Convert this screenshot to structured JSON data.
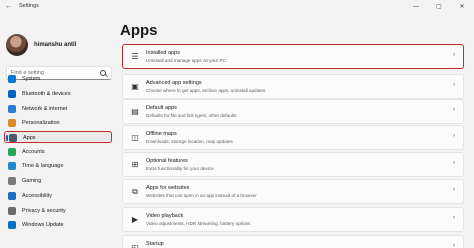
{
  "window": {
    "back_glyph": "←",
    "title": "Settings",
    "controls": [
      "—",
      "▢",
      "✕"
    ]
  },
  "profile": {
    "name": "himanshu antil"
  },
  "search": {
    "placeholder": "Find a setting"
  },
  "nav": [
    {
      "label": "System",
      "icon": "system-icon",
      "color": "#0078d4"
    },
    {
      "label": "Bluetooth & devices",
      "icon": "bluetooth-icon",
      "color": "#0067c0"
    },
    {
      "label": "Network & internet",
      "icon": "network-icon",
      "color": "#2b7bd6"
    },
    {
      "label": "Personalization",
      "icon": "brush-icon",
      "color": "#d88b2c"
    },
    {
      "label": "Apps",
      "icon": "apps-icon",
      "color": "#4a5a6a",
      "active": true
    },
    {
      "label": "Accounts",
      "icon": "accounts-icon",
      "color": "#2aa55a"
    },
    {
      "label": "Time & language",
      "icon": "globe-icon",
      "color": "#1f8ad1"
    },
    {
      "label": "Gaming",
      "icon": "gaming-icon",
      "color": "#7a7a7a"
    },
    {
      "label": "Accessibility",
      "icon": "accessibility-icon",
      "color": "#1f6fbf"
    },
    {
      "label": "Privacy & security",
      "icon": "shield-icon",
      "color": "#6b6b6b"
    },
    {
      "label": "Windows Update",
      "icon": "update-icon",
      "color": "#0a6fc6"
    }
  ],
  "main": {
    "title": "Apps",
    "items": [
      {
        "title": "Installed apps",
        "desc": "Uninstall and manage apps on your PC",
        "icon": "list-icon",
        "glyph": "☰"
      },
      {
        "title": "Advanced app settings",
        "desc": "Choose where to get apps, archive apps, uninstall updates",
        "icon": "app-settings-icon",
        "glyph": "▣"
      },
      {
        "title": "Default apps",
        "desc": "Defaults for file and link types, other defaults",
        "icon": "default-apps-icon",
        "glyph": "▤"
      },
      {
        "title": "Offline maps",
        "desc": "Downloads, storage location, map updates",
        "icon": "map-icon",
        "glyph": "◫"
      },
      {
        "title": "Optional features",
        "desc": "Extra functionality for your device",
        "icon": "features-icon",
        "glyph": "⊞"
      },
      {
        "title": "Apps for websites",
        "desc": "Websites that can open in an app instead of a browser",
        "icon": "web-apps-icon",
        "glyph": "⧉"
      },
      {
        "title": "Video playback",
        "desc": "Video adjustments, HDR streaming, battery options",
        "icon": "video-icon",
        "glyph": "▶"
      },
      {
        "title": "Startup",
        "desc": "",
        "icon": "startup-icon",
        "glyph": "◰"
      }
    ],
    "chevron": "›"
  }
}
